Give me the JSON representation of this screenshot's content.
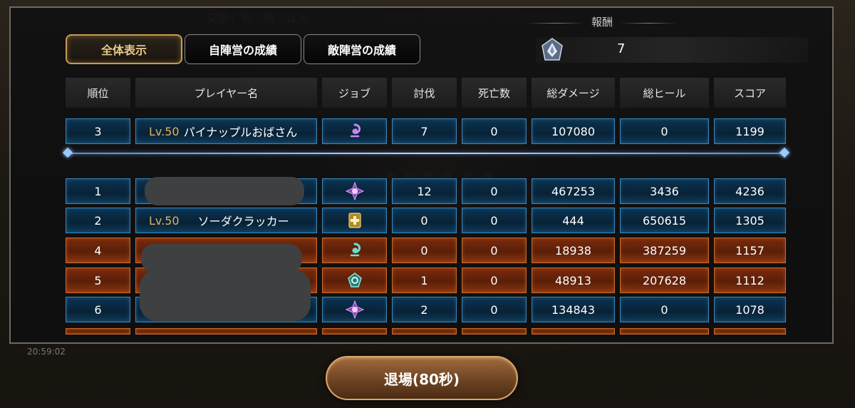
{
  "tabs": [
    {
      "label": "全体表示",
      "active": true
    },
    {
      "label": "自陣営の成績",
      "active": false
    },
    {
      "label": "敵陣営の成績",
      "active": false
    }
  ],
  "reward": {
    "label": "報酬",
    "value": "7",
    "icon": "silver-rank-emblem-icon"
  },
  "columns": [
    "順位",
    "プレイヤー名",
    "ジョブ",
    "討伐",
    "死亡数",
    "総ダメージ",
    "総ヒール",
    "スコア"
  ],
  "self_row": {
    "rank": "3",
    "level": "Lv.50",
    "name": "パイナップルおばさん",
    "job_icon": "spiral-job-icon",
    "kills": "7",
    "deaths": "0",
    "damage": "107080",
    "heal": "0",
    "score": "1199",
    "team": "blue"
  },
  "rows": [
    {
      "rank": "1",
      "level": "",
      "name": "",
      "hidden": true,
      "job_icon": "eye-sigil-job-icon",
      "kills": "12",
      "deaths": "0",
      "damage": "467253",
      "heal": "3436",
      "score": "4236",
      "team": "blue"
    },
    {
      "rank": "2",
      "level": "Lv.50",
      "name": "ソーダクラッカー",
      "hidden": false,
      "job_icon": "healer-job-icon",
      "kills": "0",
      "deaths": "0",
      "damage": "444",
      "heal": "650615",
      "score": "1305",
      "team": "blue"
    },
    {
      "rank": "4",
      "level": "",
      "name": "",
      "hidden": true,
      "job_icon": "spiral-job-icon",
      "kills": "0",
      "deaths": "0",
      "damage": "18938",
      "heal": "387259",
      "score": "1157",
      "team": "orange"
    },
    {
      "rank": "5",
      "level": "",
      "name": "",
      "hidden": true,
      "job_icon": "knot-job-icon",
      "kills": "1",
      "deaths": "0",
      "damage": "48913",
      "heal": "207628",
      "score": "1112",
      "team": "orange"
    },
    {
      "rank": "6",
      "level": "",
      "name": "",
      "hidden": true,
      "job_icon": "eye-sigil-job-icon",
      "kills": "2",
      "deaths": "0",
      "damage": "134843",
      "heal": "0",
      "score": "1078",
      "team": "blue"
    }
  ],
  "exit_button": {
    "label": "退場(80秒)"
  },
  "background": {
    "timestamp": "20:59:02"
  },
  "colors": {
    "accent_gold": "#c79a55",
    "blue_team": "#3b86b8",
    "orange_team": "#c86a28"
  }
}
